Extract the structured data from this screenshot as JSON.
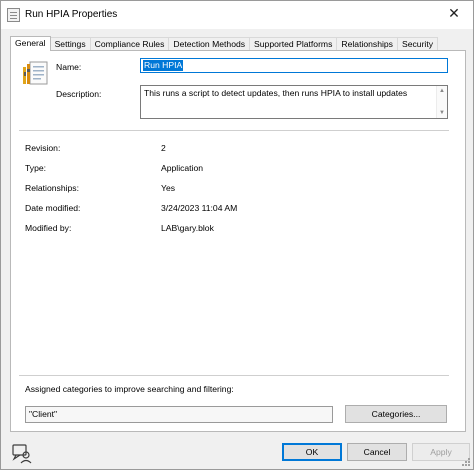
{
  "window": {
    "title": "Run HPIA Properties",
    "close_glyph": "✕"
  },
  "tabs": [
    {
      "label": "General",
      "active": true
    },
    {
      "label": "Settings"
    },
    {
      "label": "Compliance Rules"
    },
    {
      "label": "Detection Methods"
    },
    {
      "label": "Supported Platforms"
    },
    {
      "label": "Relationships"
    },
    {
      "label": "Security"
    }
  ],
  "general": {
    "name_label": "Name:",
    "name_value": "Run HPIA",
    "description_label": "Description:",
    "description_value": "This runs a script to detect updates, then runs HPIA to install updates",
    "properties": [
      {
        "label": "Revision:",
        "value": "2"
      },
      {
        "label": "Type:",
        "value": "Application"
      },
      {
        "label": "Relationships:",
        "value": "Yes"
      },
      {
        "label": "Date modified:",
        "value": "3/24/2023 11:04 AM"
      },
      {
        "label": "Modified by:",
        "value": "LAB\\gary.blok"
      }
    ],
    "categories_label": "Assigned categories to improve searching and filtering:",
    "categories_value": "\"Client\"",
    "categories_button": "Categories..."
  },
  "footer": {
    "ok": "OK",
    "cancel": "Cancel",
    "apply": "Apply"
  },
  "icons": {
    "window": "properties-window-icon",
    "item": "configuration-item-icon",
    "help": "help-icon"
  },
  "colors": {
    "selection": "#0078d7",
    "default_button_border": "#0078d7"
  }
}
